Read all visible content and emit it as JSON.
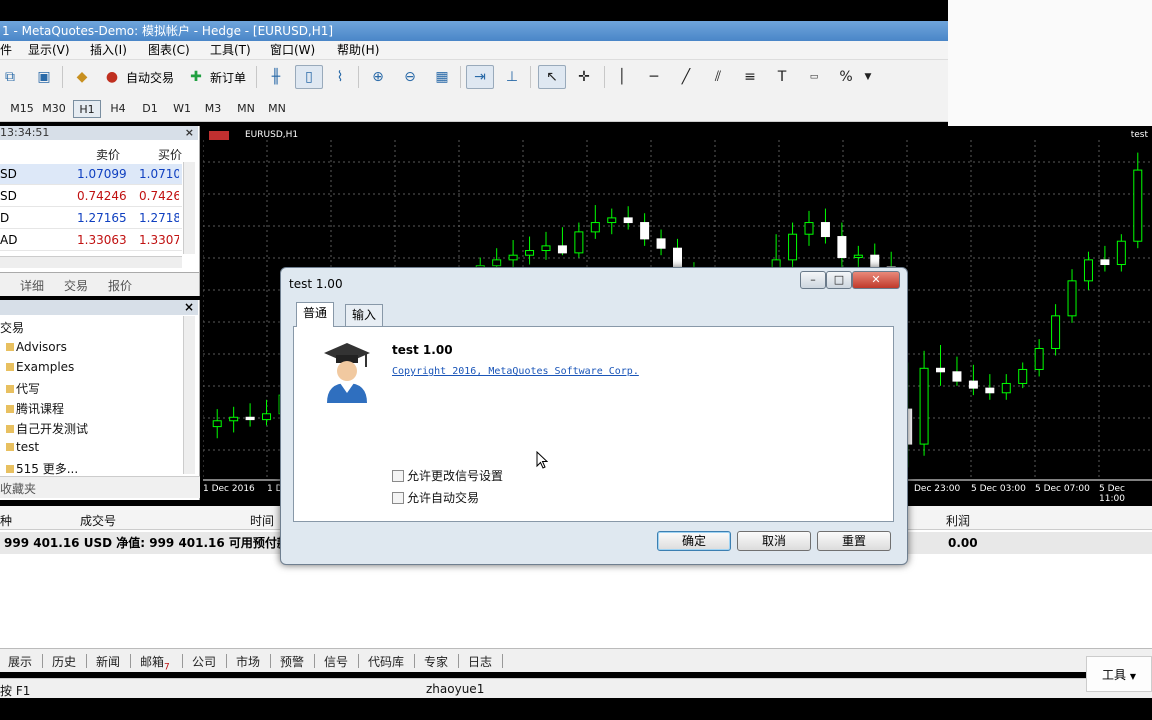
{
  "window": {
    "title": "1 - MetaQuotes-Demo: 模拟帐户 - Hedge - [EURUSD,H1]"
  },
  "menu": {
    "items": [
      "显示(V)",
      "插入(I)",
      "图表(C)",
      "工具(T)",
      "窗口(W)",
      "帮助(H)"
    ]
  },
  "toolbar": {
    "auto_trade_label": "自动交易",
    "new_order_label": "新订单"
  },
  "timeframes": {
    "items": [
      "M15",
      "M30",
      "H1",
      "H4",
      "D1",
      "W1",
      "MN"
    ],
    "active": "H1"
  },
  "market_watch": {
    "time": "13:34:51",
    "columns": {
      "bid": "卖价",
      "ask": "买价"
    },
    "rows": [
      {
        "symbol": "SD",
        "bid": "1.07099",
        "ask": "1.0710",
        "color": "#1040c0"
      },
      {
        "symbol": "SD",
        "bid": "0.74246",
        "ask": "0.7426",
        "color": "#c01010"
      },
      {
        "symbol": "D",
        "bid": "1.27165",
        "ask": "1.2718",
        "color": "#1040c0"
      },
      {
        "symbol": "AD",
        "bid": "1.33063",
        "ask": "1.3307",
        "color": "#c01010"
      }
    ],
    "tabs": [
      "详细",
      "交易",
      "报价"
    ]
  },
  "navigator": {
    "items": [
      "交易",
      "Advisors",
      "Examples",
      "代写",
      "腾讯课程",
      "自己开发测试",
      "test",
      "515 更多..."
    ],
    "footer_tab": "收藏夹"
  },
  "chart": {
    "symbol_label": "EURUSD,H1",
    "indicator_label": "test",
    "time_labels": [
      "1 Dec 2016",
      "1 D",
      "Dec 23:00",
      "5 Dec 03:00",
      "5 Dec 07:00",
      "5 Dec 11:00"
    ],
    "colors": {
      "up": "#00ff00",
      "down": "#ffffff",
      "grid": "#5a5a5a",
      "background": "#000000"
    }
  },
  "chart_data": {
    "type": "candlestick",
    "title": "EURUSD,H1",
    "candles": [
      {
        "o": 1.0595,
        "h": 1.061,
        "l": 1.0585,
        "c": 1.06
      },
      {
        "o": 1.06,
        "h": 1.0612,
        "l": 1.059,
        "c": 1.0603
      },
      {
        "o": 1.0603,
        "h": 1.0615,
        "l": 1.0595,
        "c": 1.0601
      },
      {
        "o": 1.0601,
        "h": 1.0618,
        "l": 1.0596,
        "c": 1.0606
      },
      {
        "o": 1.0606,
        "h": 1.063,
        "l": 1.06,
        "c": 1.0622
      },
      {
        "o": 1.0622,
        "h": 1.064,
        "l": 1.0615,
        "c": 1.0636
      },
      {
        "o": 1.0636,
        "h": 1.065,
        "l": 1.0628,
        "c": 1.0645
      },
      {
        "o": 1.0645,
        "h": 1.066,
        "l": 1.0638,
        "c": 1.0648
      },
      {
        "o": 1.0648,
        "h": 1.0665,
        "l": 1.064,
        "c": 1.065
      },
      {
        "o": 1.065,
        "h": 1.0668,
        "l": 1.0642,
        "c": 1.0652
      },
      {
        "o": 1.0652,
        "h": 1.067,
        "l": 1.0645,
        "c": 1.0656
      },
      {
        "o": 1.0656,
        "h": 1.0672,
        "l": 1.0646,
        "c": 1.0648
      },
      {
        "o": 1.0648,
        "h": 1.0668,
        "l": 1.064,
        "c": 1.066
      },
      {
        "o": 1.066,
        "h": 1.069,
        "l": 1.0655,
        "c": 1.0685
      },
      {
        "o": 1.0685,
        "h": 1.071,
        "l": 1.0678,
        "c": 1.0705
      },
      {
        "o": 1.0705,
        "h": 1.0725,
        "l": 1.07,
        "c": 1.072
      },
      {
        "o": 1.072,
        "h": 1.074,
        "l": 1.0712,
        "c": 1.0733
      },
      {
        "o": 1.0733,
        "h": 1.0748,
        "l": 1.0725,
        "c": 1.0738
      },
      {
        "o": 1.0738,
        "h": 1.0755,
        "l": 1.073,
        "c": 1.0742
      },
      {
        "o": 1.0742,
        "h": 1.0758,
        "l": 1.0734,
        "c": 1.0746
      },
      {
        "o": 1.0746,
        "h": 1.0762,
        "l": 1.0738,
        "c": 1.075
      },
      {
        "o": 1.075,
        "h": 1.0766,
        "l": 1.0742,
        "c": 1.0744
      },
      {
        "o": 1.0744,
        "h": 1.077,
        "l": 1.074,
        "c": 1.0762
      },
      {
        "o": 1.0762,
        "h": 1.0785,
        "l": 1.0756,
        "c": 1.077
      },
      {
        "o": 1.077,
        "h": 1.0782,
        "l": 1.076,
        "c": 1.0774
      },
      {
        "o": 1.0774,
        "h": 1.0784,
        "l": 1.0764,
        "c": 1.077
      },
      {
        "o": 1.077,
        "h": 1.0778,
        "l": 1.075,
        "c": 1.0756
      },
      {
        "o": 1.0756,
        "h": 1.0764,
        "l": 1.0742,
        "c": 1.0748
      },
      {
        "o": 1.0748,
        "h": 1.0756,
        "l": 1.0722,
        "c": 1.0728
      },
      {
        "o": 1.0728,
        "h": 1.0736,
        "l": 1.0716,
        "c": 1.0722
      },
      {
        "o": 1.0722,
        "h": 1.073,
        "l": 1.0712,
        "c": 1.072
      },
      {
        "o": 1.072,
        "h": 1.0728,
        "l": 1.0696,
        "c": 1.0702
      },
      {
        "o": 1.0702,
        "h": 1.0712,
        "l": 1.069,
        "c": 1.0696
      },
      {
        "o": 1.0696,
        "h": 1.073,
        "l": 1.0692,
        "c": 1.0724
      },
      {
        "o": 1.0724,
        "h": 1.076,
        "l": 1.0718,
        "c": 1.0738
      },
      {
        "o": 1.0738,
        "h": 1.077,
        "l": 1.073,
        "c": 1.076
      },
      {
        "o": 1.076,
        "h": 1.078,
        "l": 1.075,
        "c": 1.077
      },
      {
        "o": 1.077,
        "h": 1.0782,
        "l": 1.0752,
        "c": 1.0758
      },
      {
        "o": 1.0758,
        "h": 1.077,
        "l": 1.073,
        "c": 1.074
      },
      {
        "o": 1.074,
        "h": 1.075,
        "l": 1.0728,
        "c": 1.0742
      },
      {
        "o": 1.0742,
        "h": 1.0752,
        "l": 1.0728,
        "c": 1.0732
      },
      {
        "o": 1.0732,
        "h": 1.0745,
        "l": 1.06,
        "c": 1.061
      },
      {
        "o": 1.061,
        "h": 1.065,
        "l": 1.056,
        "c": 1.058
      },
      {
        "o": 1.058,
        "h": 1.066,
        "l": 1.057,
        "c": 1.0645
      },
      {
        "o": 1.0645,
        "h": 1.0665,
        "l": 1.063,
        "c": 1.0642
      },
      {
        "o": 1.0642,
        "h": 1.0655,
        "l": 1.063,
        "c": 1.0634
      },
      {
        "o": 1.0634,
        "h": 1.0648,
        "l": 1.0622,
        "c": 1.0628
      },
      {
        "o": 1.0628,
        "h": 1.064,
        "l": 1.0618,
        "c": 1.0624
      },
      {
        "o": 1.0624,
        "h": 1.064,
        "l": 1.0618,
        "c": 1.0632
      },
      {
        "o": 1.0632,
        "h": 1.065,
        "l": 1.0628,
        "c": 1.0644
      },
      {
        "o": 1.0644,
        "h": 1.067,
        "l": 1.0638,
        "c": 1.0662
      },
      {
        "o": 1.0662,
        "h": 1.07,
        "l": 1.0656,
        "c": 1.069
      },
      {
        "o": 1.069,
        "h": 1.073,
        "l": 1.0684,
        "c": 1.072
      },
      {
        "o": 1.072,
        "h": 1.0745,
        "l": 1.0712,
        "c": 1.0738
      },
      {
        "o": 1.0738,
        "h": 1.075,
        "l": 1.0728,
        "c": 1.0734
      },
      {
        "o": 1.0734,
        "h": 1.076,
        "l": 1.0728,
        "c": 1.0754
      },
      {
        "o": 1.0754,
        "h": 1.083,
        "l": 1.0748,
        "c": 1.0815
      }
    ]
  },
  "dialog": {
    "title": "test 1.00",
    "tabs": [
      "普通",
      "输入"
    ],
    "program_name": "test 1.00",
    "copyright": "Copyright 2016, MetaQuotes Software Corp.",
    "checkboxes": [
      "允许更改信号设置",
      "允许自动交易"
    ],
    "buttons": {
      "ok": "确定",
      "cancel": "取消",
      "reset": "重置"
    }
  },
  "terminal": {
    "columns": [
      "种",
      "成交号",
      "时间",
      "利润"
    ],
    "balance_text": "999 401.16 USD  净值: 999 401.16  可用预付款: 9",
    "profit_value": "0.00",
    "tabs": [
      "展示",
      "历史",
      "新闻",
      "邮箱",
      "公司",
      "市场",
      "预警",
      "信号",
      "代码库",
      "专家",
      "日志"
    ],
    "mail_count": "7"
  },
  "statusbar": {
    "help_text": "按 F1",
    "user": "zhaoyue1"
  },
  "tools_button": {
    "label": "工具"
  }
}
